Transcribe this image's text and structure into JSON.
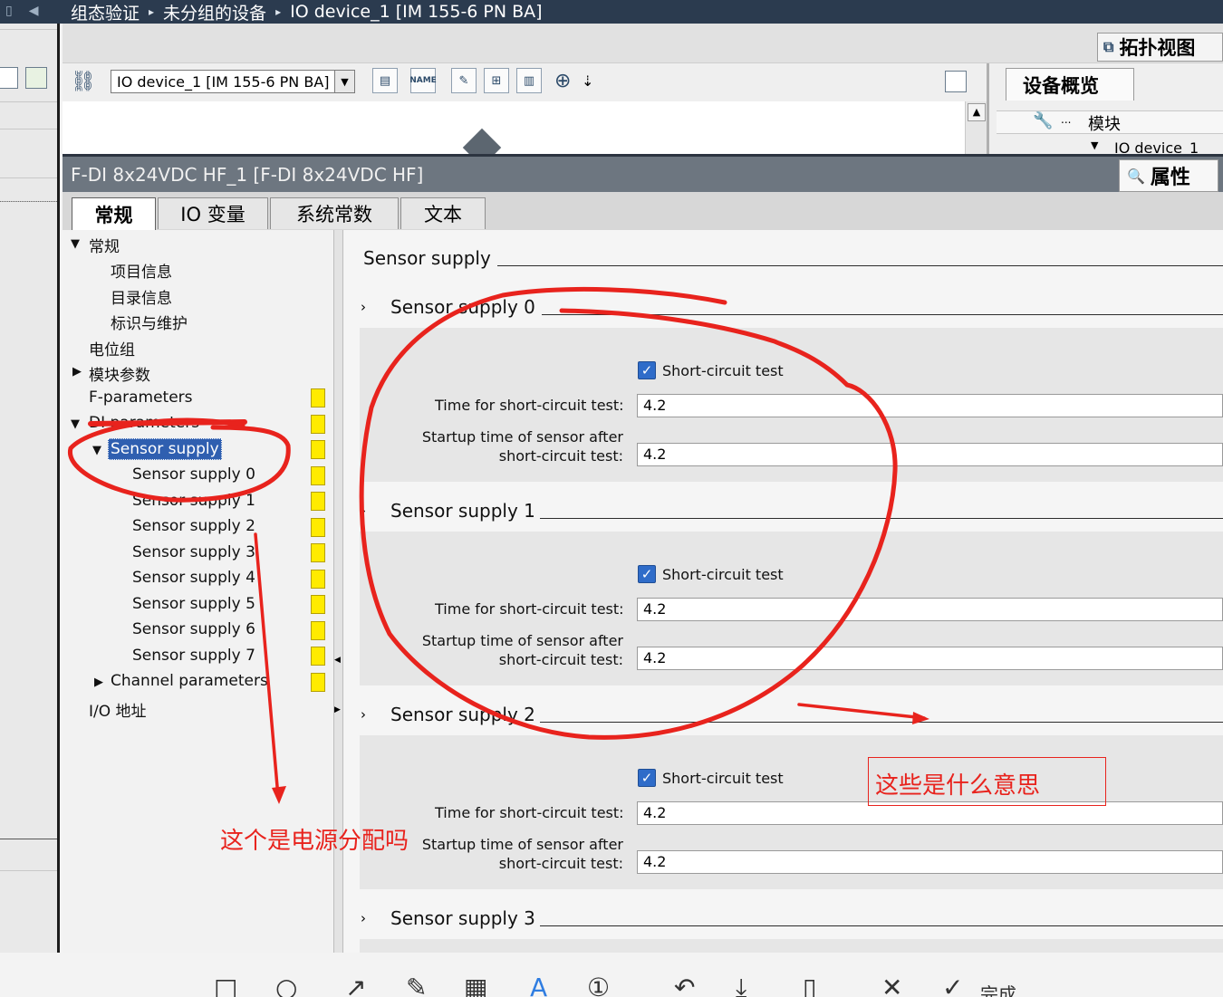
{
  "breadcrumb": {
    "items": [
      "组态验证",
      "未分组的设备",
      "IO device_1 [IM 155-6 PN BA]"
    ],
    "separator": "▸"
  },
  "topology_view": {
    "label": "拓扑视图",
    "icon": "network-topology-icon"
  },
  "toolbar": {
    "device_select": "IO device_1 [IM 155-6 PN BA]"
  },
  "device_overview": {
    "tab_label": "设备概览",
    "column_module": "模块",
    "column_dots": "...",
    "tree_row": "IO device_1"
  },
  "properties": {
    "title": "F-DI 8x24VDC HF_1 [F-DI 8x24VDC HF]",
    "tab_label": "属性"
  },
  "tabs": [
    "常规",
    "IO 变量",
    "系统常数",
    "文本"
  ],
  "nav_tree": [
    {
      "label": "常规",
      "expanded": true
    },
    {
      "label": "项目信息"
    },
    {
      "label": "目录信息"
    },
    {
      "label": "标识与维护"
    },
    {
      "label": "电位组"
    },
    {
      "label": "模块参数",
      "expanded": false
    },
    {
      "label": "F-parameters"
    },
    {
      "label": "DI parameters",
      "expanded": true
    },
    {
      "label": "Sensor supply",
      "expanded": true,
      "selected": true
    },
    {
      "label": "Sensor supply 0"
    },
    {
      "label": "Sensor supply 1"
    },
    {
      "label": "Sensor supply 2"
    },
    {
      "label": "Sensor supply 3"
    },
    {
      "label": "Sensor supply 4"
    },
    {
      "label": "Sensor supply 5"
    },
    {
      "label": "Sensor supply 6"
    },
    {
      "label": "Sensor supply 7"
    },
    {
      "label": "Channel parameters",
      "expanded": false
    },
    {
      "label": "I/O 地址"
    }
  ],
  "content": {
    "section_title": "Sensor supply",
    "sensor_supplies": [
      {
        "title": "Sensor supply 0",
        "checkbox_label": "Short-circuit test",
        "checked": true,
        "time_label": "Time for short-circuit test:",
        "time_value": "4.2",
        "startup_label_1": "Startup time of sensor after",
        "startup_label_2": "short-circuit test:",
        "startup_value": "4.2"
      },
      {
        "title": "Sensor supply 1",
        "checkbox_label": "Short-circuit test",
        "checked": true,
        "time_label": "Time for short-circuit test:",
        "time_value": "4.2",
        "startup_label_1": "Startup time of sensor after",
        "startup_label_2": "short-circuit test:",
        "startup_value": "4.2"
      },
      {
        "title": "Sensor supply 2",
        "checkbox_label": "Short-circuit test",
        "checked": true,
        "time_label": "Time for short-circuit test:",
        "time_value": "4.2",
        "startup_label_1": "Startup time of sensor after",
        "startup_label_2": "short-circuit test:",
        "startup_value": "4.2"
      },
      {
        "title": "Sensor supply 3"
      }
    ]
  },
  "annotations": {
    "question_left": "这个是电源分配吗",
    "question_right": "这些是什么意思",
    "color": "#e8231d"
  },
  "bottom_toolbar": {
    "done_label": "完成",
    "icons": [
      "rectangle-icon",
      "ellipse-icon",
      "arrow-icon",
      "pen-icon",
      "mosaic-icon",
      "text-icon",
      "number-icon",
      "undo-icon",
      "download-icon",
      "pin-icon",
      "close-icon",
      "check-icon"
    ]
  }
}
